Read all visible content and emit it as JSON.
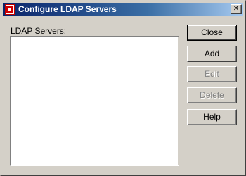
{
  "window": {
    "title": "Configure LDAP Servers",
    "close_glyph": "✕"
  },
  "main": {
    "list_label": "LDAP Servers:",
    "servers": []
  },
  "buttons": {
    "close": "Close",
    "add": "Add",
    "edit": "Edit",
    "delete": "Delete",
    "help": "Help"
  },
  "states": {
    "edit_enabled": false,
    "delete_enabled": false
  },
  "icons": {
    "app": "app-icon",
    "close": "close-icon"
  },
  "colors": {
    "titlebar_start": "#0a246a",
    "titlebar_end": "#a6caf0",
    "face": "#d4d0c8",
    "disabled_text": "#808080"
  }
}
